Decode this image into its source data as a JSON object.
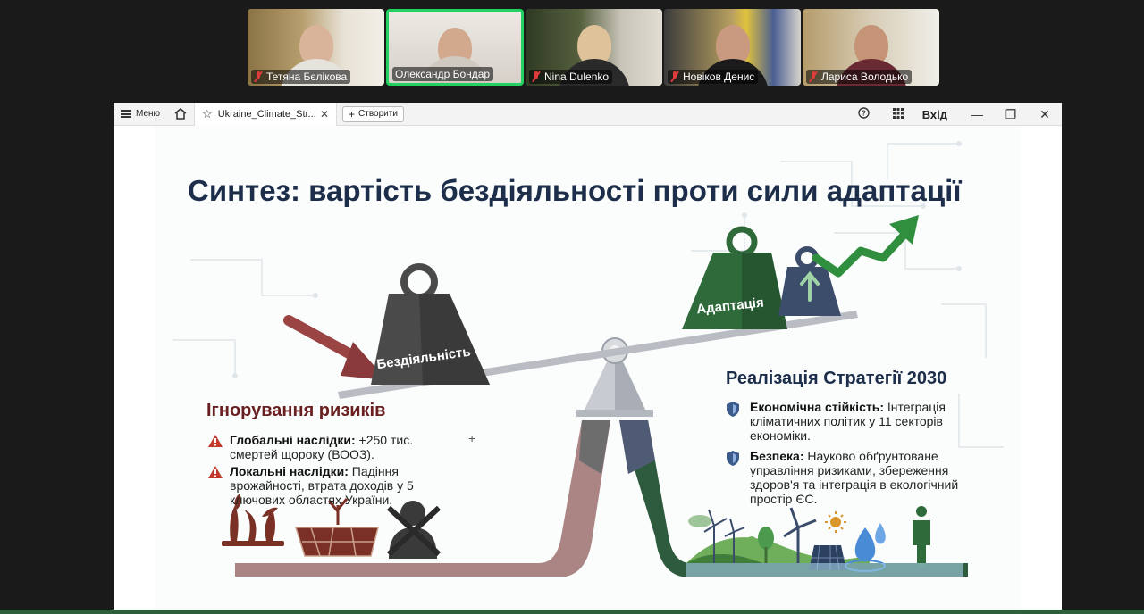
{
  "participants": [
    {
      "name": "Тетяна Бєлікова",
      "muted": true,
      "active": false
    },
    {
      "name": "Олександр Бондар",
      "muted": false,
      "active": true
    },
    {
      "name": "Nina Dulenko",
      "muted": true,
      "active": false
    },
    {
      "name": "Новіков Денис",
      "muted": true,
      "active": false
    },
    {
      "name": "Лариса Володько",
      "muted": true,
      "active": false
    }
  ],
  "window": {
    "menu_label": "Меню",
    "tab_title": "Ukraine_Climate_Str...",
    "new_button": "Створити",
    "login_label": "Вхід"
  },
  "slide": {
    "title": "Синтез: вартість бездіяльності проти сили адаптації",
    "weight_left": "Бездіяльність",
    "weight_right": "Адаптація",
    "risks": {
      "heading": "Ігнорування ризиків",
      "items": [
        {
          "label": "Глобальні наслідки:",
          "text": "+250 тис. смертей щороку (ВООЗ)."
        },
        {
          "label": "Локальні наслідки:",
          "text": "Падіння врожайності, втрата доходів у 5 ключових областях України."
        }
      ]
    },
    "strategy": {
      "heading": "Реалізація Стратегії 2030",
      "items": [
        {
          "label": "Економічна стійкість:",
          "text": "Інтеграція кліматичних політик у 11 секторів економіки."
        },
        {
          "label": "Безпека:",
          "text": "Науково обґрунтоване управління ризиками, збереження здоров'я та інтеграція в екологічний простір ЄС."
        }
      ]
    }
  },
  "colors": {
    "active_border": "#23d160",
    "title": "#1c2e4a",
    "risk": "#6a2020",
    "green": "#2f6b3a",
    "navy": "#3b4d6b"
  }
}
